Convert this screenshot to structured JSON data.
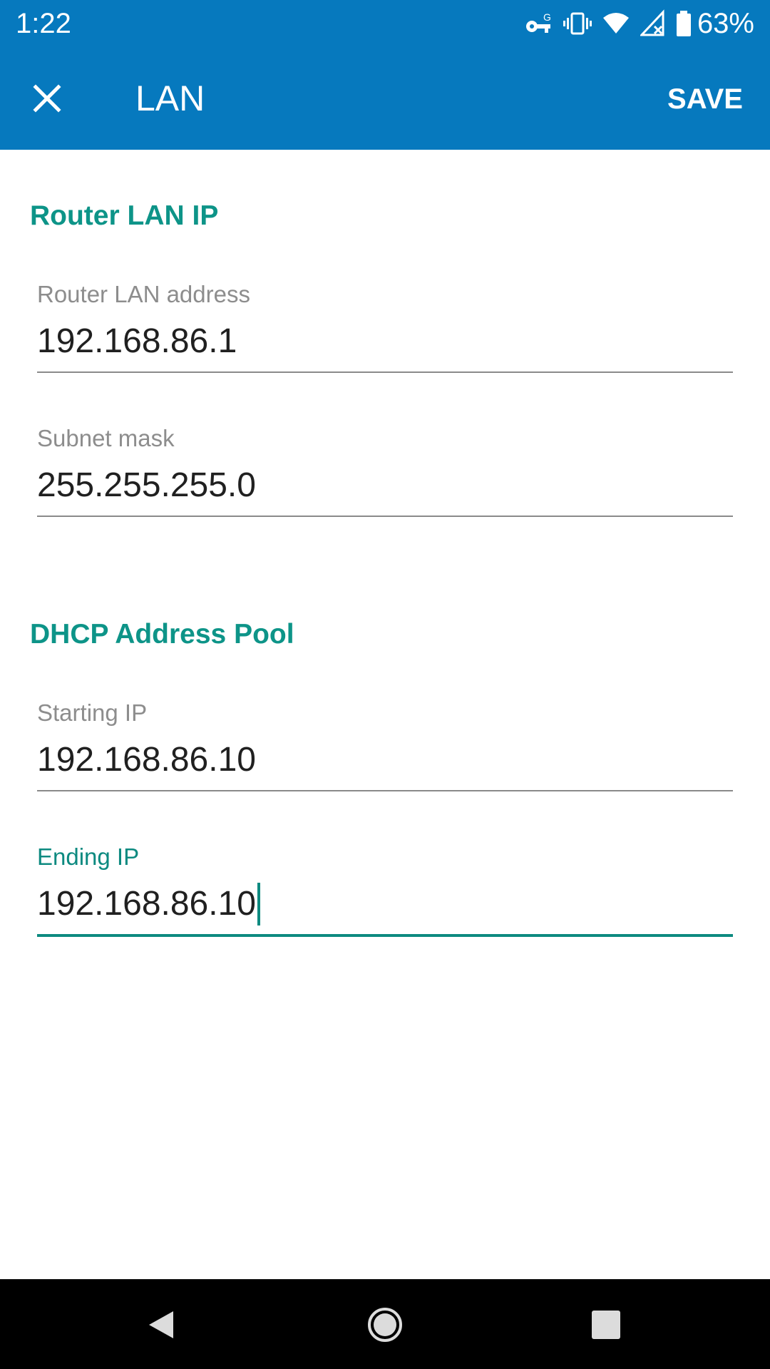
{
  "status_bar": {
    "time": "1:22",
    "battery": "63%",
    "icons": [
      "vpn-key-icon",
      "vibrate-icon",
      "wifi-icon",
      "signal-off-icon",
      "battery-icon"
    ]
  },
  "app_bar": {
    "title": "LAN",
    "save_label": "SAVE",
    "close_icon": "close-icon"
  },
  "sections": {
    "router": {
      "header": "Router LAN IP",
      "address_label": "Router LAN address",
      "address_value": "192.168.86.1",
      "mask_label": "Subnet mask",
      "mask_value": "255.255.255.0"
    },
    "dhcp": {
      "header": "DHCP Address Pool",
      "start_label": "Starting IP",
      "start_value": "192.168.86.10",
      "end_label": "Ending IP",
      "end_value": "192.168.86.10"
    }
  },
  "nav_bar": {
    "icons": [
      "back-icon",
      "home-icon",
      "recents-icon"
    ]
  },
  "colors": {
    "app_bar": "#0679be",
    "accent": "#0d9488",
    "focus_line": "#0d8a80"
  }
}
